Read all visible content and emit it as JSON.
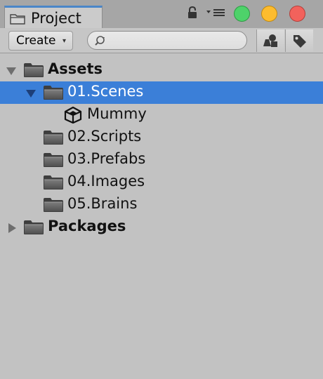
{
  "window": {
    "tab_title": "Project",
    "icons": {
      "tab": "folder-icon",
      "lock": "lock-icon",
      "menu": "tab-menu-icon",
      "close": "close-dot",
      "minimize": "minimize-dot",
      "maximize": "maximize-dot"
    },
    "colors": {
      "close": "#f2625c",
      "minimize": "#fdbc2e",
      "maximize": "#4ed26a"
    }
  },
  "toolbar": {
    "create_label": "Create",
    "create_arrow": "▾",
    "search": {
      "value": "",
      "placeholder": ""
    },
    "buttons": [
      "filter-by-type-icon",
      "filter-by-label-icon"
    ]
  },
  "tree": {
    "selection_color": "#3b7fd8",
    "items": [
      {
        "label": "Assets",
        "icon": "folder-icon",
        "expanded": true,
        "selected": false,
        "bold": true
      },
      {
        "label": "01.Scenes",
        "icon": "folder-icon",
        "expanded": true,
        "selected": true,
        "bold": false
      },
      {
        "label": "Mummy",
        "icon": "unity-scene-icon",
        "selected": false,
        "bold": false
      },
      {
        "label": "02.Scripts",
        "icon": "folder-icon",
        "selected": false,
        "bold": false
      },
      {
        "label": "03.Prefabs",
        "icon": "folder-icon",
        "selected": false,
        "bold": false
      },
      {
        "label": "04.Images",
        "icon": "folder-icon",
        "selected": false,
        "bold": false
      },
      {
        "label": "05.Brains",
        "icon": "folder-icon",
        "selected": false,
        "bold": false
      },
      {
        "label": "Packages",
        "icon": "folder-icon",
        "expanded": false,
        "selected": false,
        "bold": true
      }
    ]
  }
}
